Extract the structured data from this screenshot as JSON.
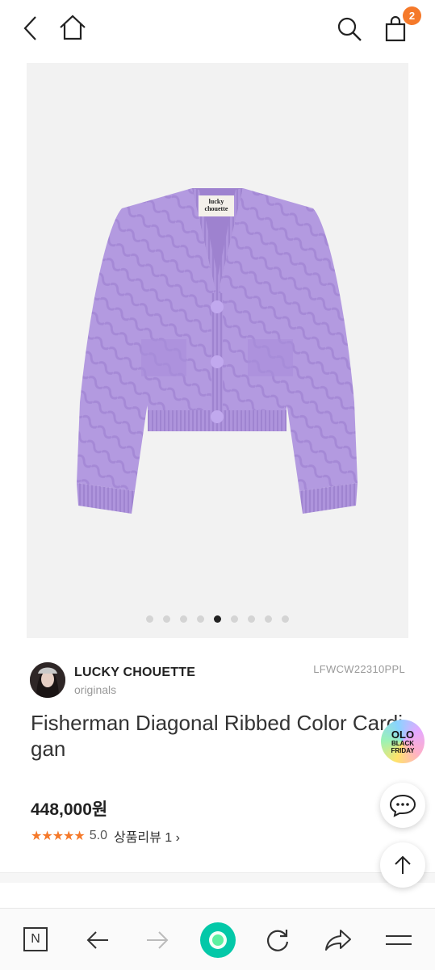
{
  "header": {
    "back_icon": "chevron-left-icon",
    "home_icon": "home-icon",
    "search_icon": "search-icon",
    "cart_icon": "shopping-bag-icon",
    "cart_count": "2"
  },
  "gallery": {
    "image": "purple cable-knit cardigan",
    "label_text": "lucky chouette",
    "image_count": 9,
    "active_index": 4
  },
  "brand": {
    "name": "LUCKY CHOUETTE",
    "subtitle": "originals",
    "sku": "LFWCW22310PPL"
  },
  "product": {
    "title": "Fisherman Diagonal Ribbed Color Cardigan",
    "price": "448,000원",
    "stars": "★★★★★",
    "rating": "5.0",
    "review_label": "상품리뷰 1 ›"
  },
  "floating": {
    "promo_line1": "OLO",
    "promo_line2": "BLACK",
    "promo_line3": "FRIDAY",
    "chat_icon": "chat-bubble-icon",
    "top_icon": "arrow-up-icon"
  },
  "bottom_nav": {
    "n_label": "N",
    "back_icon": "arrow-left-icon",
    "forward_icon": "arrow-right-icon",
    "green_icon": "green-dot-icon",
    "reload_icon": "reload-icon",
    "share_icon": "share-icon",
    "menu_icon": "menu-icon"
  },
  "colors": {
    "accent": "#f5792a",
    "cardigan": "#b39ae0",
    "green": "#03c8a8"
  }
}
